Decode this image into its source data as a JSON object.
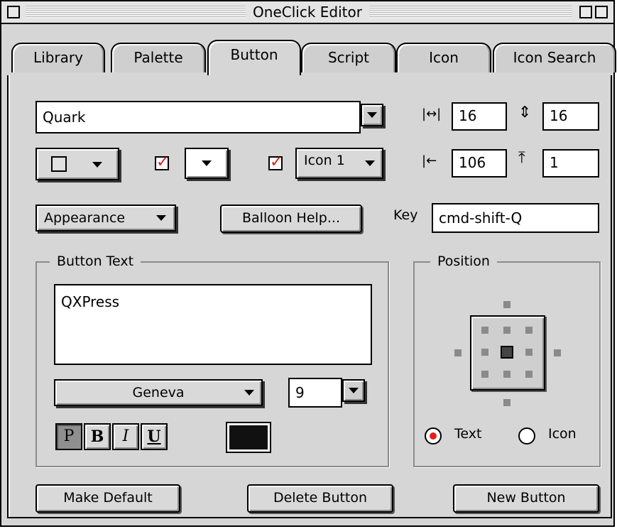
{
  "window": {
    "title": "OneClick Editor"
  },
  "tabs": [
    {
      "label": "Library",
      "active": false
    },
    {
      "label": "Palette",
      "active": false
    },
    {
      "label": "Button",
      "active": true
    },
    {
      "label": "Script",
      "active": false
    },
    {
      "label": "Icon",
      "active": false
    },
    {
      "label": "Icon Search",
      "active": false
    }
  ],
  "palette_field": {
    "value": "Quark"
  },
  "size": {
    "width": "16",
    "height": "16"
  },
  "offset": {
    "left": "106",
    "top": "1"
  },
  "icon_popup": {
    "value": "Icon 1",
    "checked": true
  },
  "color_popup": {
    "checked": true
  },
  "appearance_button": "Appearance",
  "balloon_help_button": "Balloon Help...",
  "key": {
    "label": "Key",
    "value": "cmd-shift-Q"
  },
  "button_text": {
    "group_title": "Button Text",
    "text": "QXPress",
    "font": "Geneva",
    "size": "9",
    "styles": [
      "P",
      "B",
      "I",
      "U"
    ],
    "active_style": "P",
    "text_color": "#111111"
  },
  "position": {
    "group_title": "Position",
    "radio_text": "Text",
    "radio_icon": "Icon",
    "selected": "Text"
  },
  "footer": {
    "make_default": "Make Default",
    "delete_button": "Delete Button",
    "new_button": "New Button"
  },
  "colors": {
    "window_bg": "#d6d6d6",
    "accent_red": "#e2201a"
  }
}
